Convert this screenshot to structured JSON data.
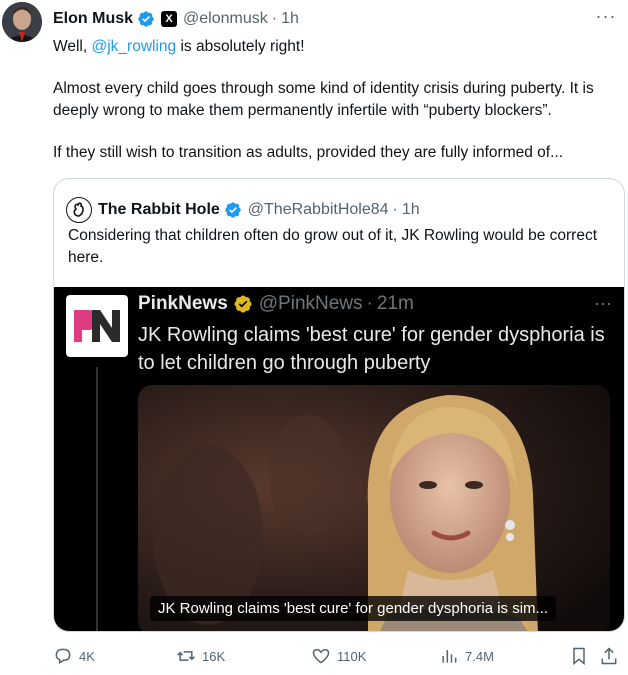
{
  "tweet": {
    "author_name": "Elon Musk",
    "x_badge": "X",
    "handle": "@elonmusk",
    "separator": "·",
    "time": "1h",
    "more": "···",
    "line1_prefix": "Well, ",
    "line1_mention": "@jk_rowling",
    "line1_suffix": " is absolutely right!",
    "para2": "Almost every child goes through some kind of identity crisis during puberty. It is deeply wrong to make them permanently infertile with “puberty blockers”.",
    "para3": "If they still wish to transition as adults, provided they are fully informed of..."
  },
  "quote": {
    "author_name": "The Rabbit Hole",
    "handle": "@TheRabbitHole84",
    "separator": "·",
    "time": "1h",
    "text": "Considering that children often do grow out of it, JK Rowling would be correct here."
  },
  "embedded": {
    "author_name": "PinkNews",
    "handle": "@PinkNews",
    "separator": "·",
    "time": "21m",
    "more": "···",
    "text": "JK Rowling claims 'best cure' for gender dysphoria is to let children go through puberty",
    "caption": "JK Rowling claims 'best cure' for gender dysphoria is sim...",
    "logo_text": "PN"
  },
  "actions": {
    "replies": "4K",
    "reposts": "16K",
    "likes": "110K",
    "views": "7.4M"
  },
  "colors": {
    "link": "#1d9bf0",
    "muted": "#536471",
    "verified_blue": "#1d9bf0",
    "verified_gold": "#e2b719",
    "pinknews_pink": "#e03c82"
  },
  "icons": [
    "verified-icon",
    "x-badge-icon",
    "more-icon",
    "reply-icon",
    "repost-icon",
    "like-icon",
    "views-icon",
    "bookmark-icon",
    "share-icon"
  ]
}
